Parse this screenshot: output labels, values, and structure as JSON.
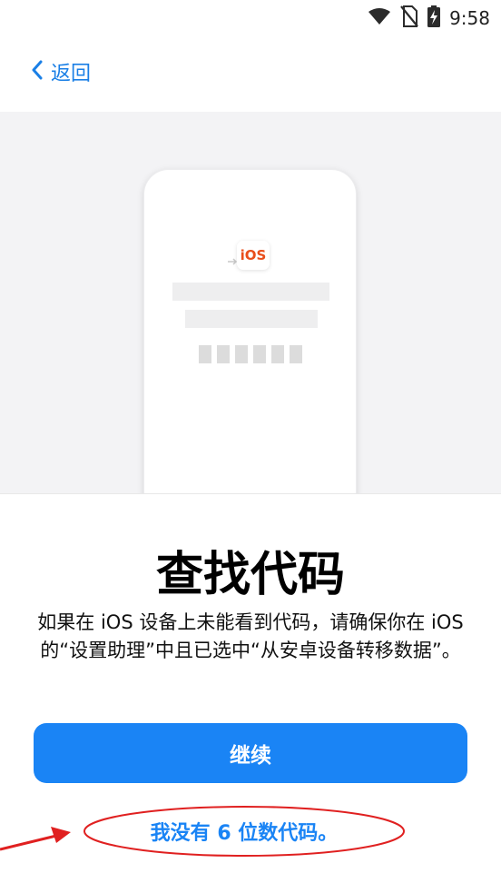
{
  "status_bar": {
    "time": "9:58",
    "icons": [
      "wifi-icon",
      "no-sim-icon",
      "battery-charging-icon"
    ]
  },
  "nav": {
    "back_label": "返回"
  },
  "illustration": {
    "badge_text": "iOS"
  },
  "content": {
    "title": "查找代码",
    "description": "如果在 iOS 设备上未能看到代码，请确保你在 iOS 的“设置助理”中且已选中“从安卓设备转移数据”。",
    "continue_label": "继续",
    "no_code_label": "我没有 6 位数代码。"
  },
  "colors": {
    "accent": "#1a84f5",
    "annotation": "#e02020",
    "illustration_bg": "#f3f3f5"
  }
}
